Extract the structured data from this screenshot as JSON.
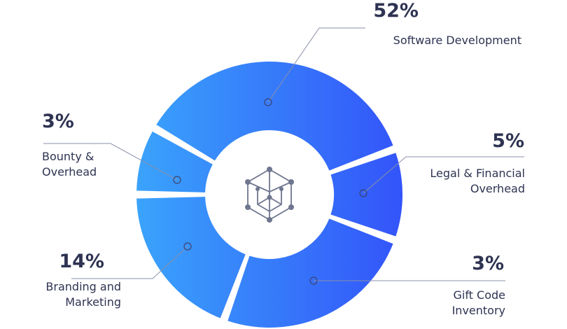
{
  "colors": {
    "gradient_start": "#3aa3fb",
    "gradient_end": "#3354fa",
    "text": "#2e3352",
    "hub_icon": "#6f768f"
  },
  "center_icon": "hexagon-network-icon",
  "chart_data": {
    "type": "donut",
    "slices": [
      {
        "label": "Software Development",
        "percent_label": "52%",
        "value": 52
      },
      {
        "label": "Legal & Financial Overhead",
        "percent_label": "5%",
        "value": 5
      },
      {
        "label": "Gift Code Inventory",
        "percent_label": "3%",
        "value": 3
      },
      {
        "label": "Branding and Marketing",
        "percent_label": "14%",
        "value": 14
      },
      {
        "label": "Bounty & Overhead",
        "percent_label": "3%",
        "value": 3
      }
    ]
  }
}
